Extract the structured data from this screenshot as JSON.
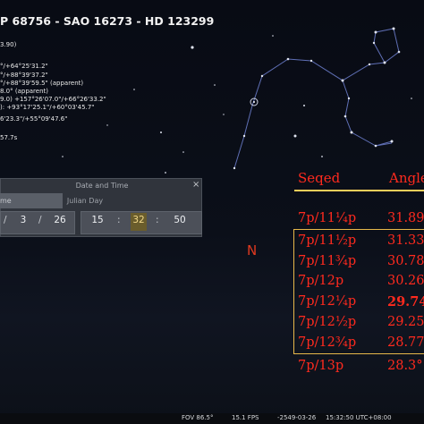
{
  "star_info": {
    "title": "P 68756 - SAO 16273 - HD 123299",
    "lines": [
      "3.90)",
      "°/+64°25'31.2\"",
      "°/+88°39'37.2\"",
      "°/+88°39'59.5\" (apparent)",
      "8.0° (apparent)",
      "9.0) +157°26'07.0\"/+66°26'33.2\"",
      "): +93°17'25.1\"/+60°03'45.7\"",
      "6'23.3\"/+55°09'47.6\"",
      "57.7s"
    ]
  },
  "date_time_dialog": {
    "title": "Date and Time",
    "close_icon": "×",
    "tabs": [
      "me",
      "Julian Day"
    ],
    "date": {
      "sep": "/",
      "month": "3",
      "day": "26"
    },
    "time": {
      "hour": "15",
      "minute": "32",
      "second": "50",
      "sep": ":"
    }
  },
  "compass": {
    "north_label": "N"
  },
  "table": {
    "headers": {
      "seqed": "Seqed",
      "angle": "Angle"
    },
    "rows": [
      {
        "seqed": "7p/11¼p",
        "angle": "31.89"
      },
      {
        "seqed": "7p/11½p",
        "angle": "31.33"
      },
      {
        "seqed": "7p/11¾p",
        "angle": "30.78"
      },
      {
        "seqed": "7p/12p",
        "angle": "30.26"
      },
      {
        "seqed": "7p/12¼p",
        "angle": "29.74",
        "bold": true
      },
      {
        "seqed": "7p/12½p",
        "angle": "29.25"
      },
      {
        "seqed": "7p/12¾p",
        "angle": "28.77"
      },
      {
        "seqed": "7p/13p",
        "angle": "28.3°"
      }
    ]
  },
  "status_bar": {
    "fov": "FOV 86.5°",
    "fps": "15.1 FPS",
    "datetime": "-2549-03-26",
    "clock": "15:32:50 UTC+08:00"
  },
  "colors": {
    "table_text": "#ff2a1e",
    "table_border": "#e7b84a",
    "north_marker": "#e0391f",
    "constellation_lines": "#5f6fb5"
  }
}
